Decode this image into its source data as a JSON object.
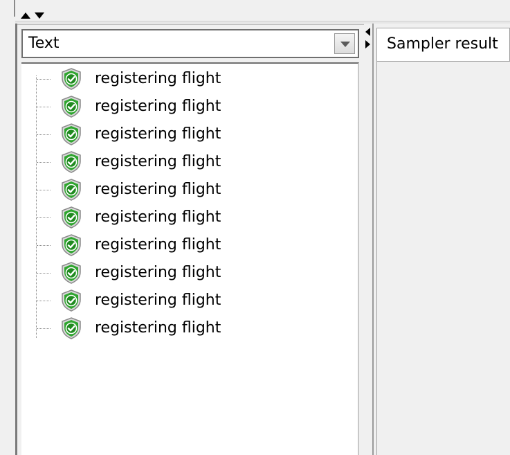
{
  "renderer_select": {
    "value": "Text"
  },
  "tree": {
    "icon": "shield-check-icon",
    "items": [
      {
        "label": "registering flight",
        "status": "success"
      },
      {
        "label": "registering flight",
        "status": "success"
      },
      {
        "label": "registering flight",
        "status": "success"
      },
      {
        "label": "registering flight",
        "status": "success"
      },
      {
        "label": "registering flight",
        "status": "success"
      },
      {
        "label": "registering flight",
        "status": "success"
      },
      {
        "label": "registering flight",
        "status": "success"
      },
      {
        "label": "registering flight",
        "status": "success"
      },
      {
        "label": "registering flight",
        "status": "success"
      },
      {
        "label": "registering flight",
        "status": "success"
      }
    ]
  },
  "result_tabs": {
    "active_label": "Sampler result"
  },
  "colors": {
    "success_green": "#2fa52f",
    "shield_border": "#8a8a8a",
    "background": "#f0f0f0"
  }
}
